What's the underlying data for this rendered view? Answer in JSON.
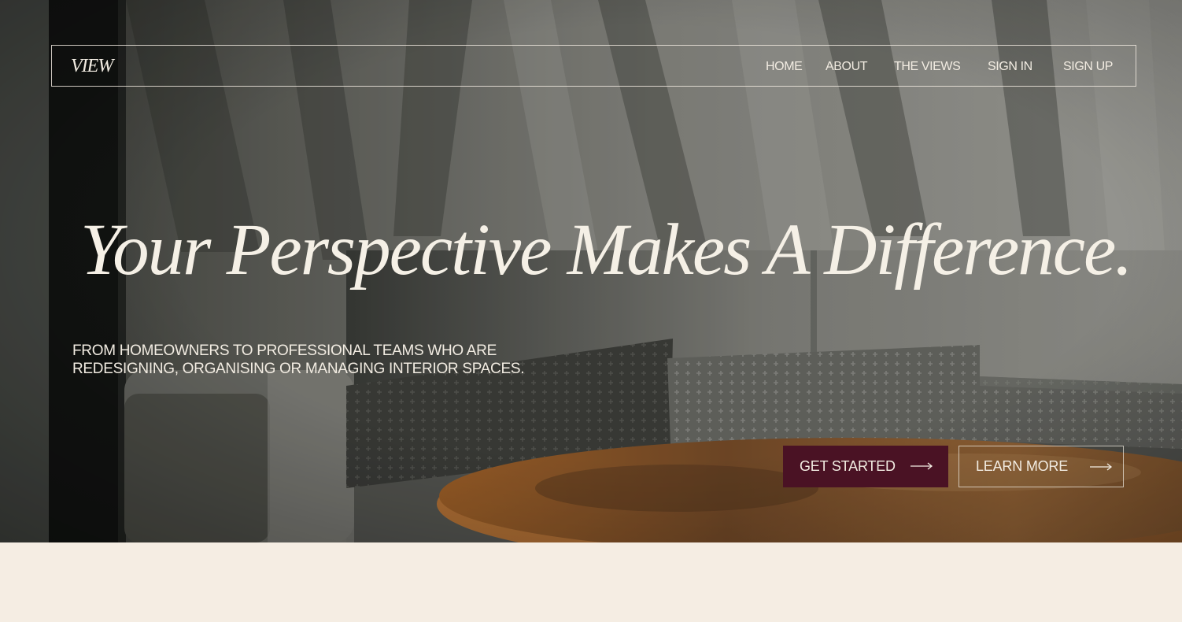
{
  "nav": {
    "logo": "VIEW",
    "links": [
      "HOME",
      "ABOUT",
      "THE VIEWS",
      "SIGN IN",
      "SIGN UP"
    ]
  },
  "hero": {
    "title": "Your Perspective Makes A Difference.",
    "subtitle_lines": [
      "FROM HOMEOWNERS TO PROFESSIONAL TEAMS WHO ARE",
      "REDESIGNING, ORGANISING OR MANAGING INTERIOR SPACES."
    ],
    "background_description_icon": "living-room-photo"
  },
  "buttons": {
    "primary_label": "GET STARTED",
    "secondary_label": "LEARN MORE"
  },
  "colors": {
    "accent": "#4a1224",
    "text_light": "#f2ece2",
    "page_background": "#f5ede3"
  }
}
